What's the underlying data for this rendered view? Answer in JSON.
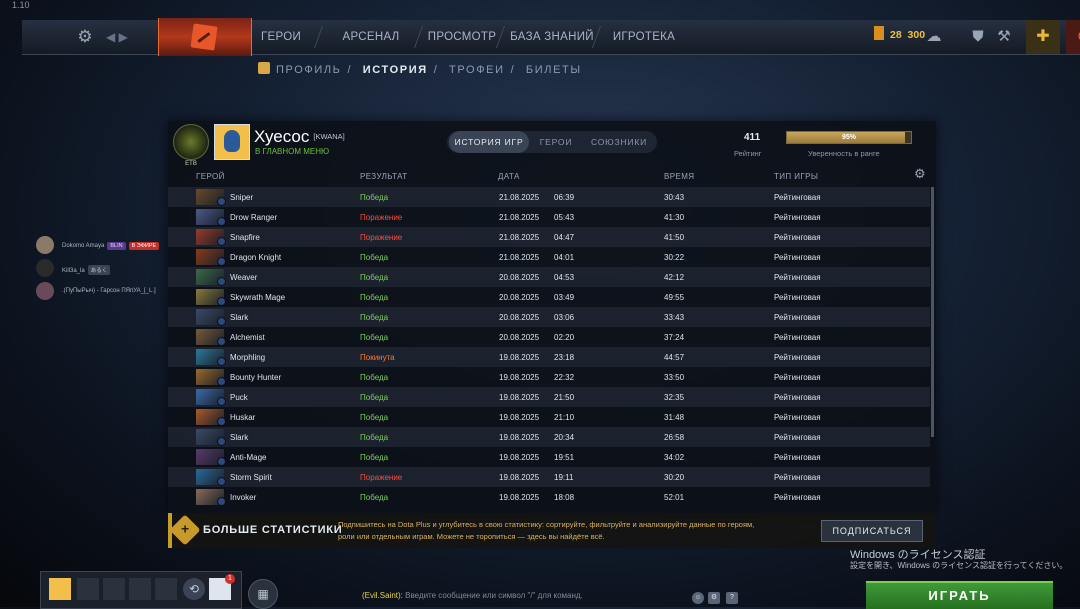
{
  "version": "1.10",
  "topnav": {
    "items": [
      "ГЕРОИ",
      "АРСЕНАЛ",
      "ПРОСМОТР",
      "БАЗА ЗНАНИЙ",
      "ИГРОТЕКА"
    ],
    "currency_a": "28",
    "currency_b": "300"
  },
  "subnav": {
    "items": [
      "ПРОФИЛЬ",
      "ИСТОРИЯ",
      "ТРОФЕИ",
      "БИЛЕТЫ"
    ],
    "active": "ИСТОРИЯ"
  },
  "profile": {
    "rank_label": "ETB",
    "name": "Хуесос",
    "tag": "[KWANA]",
    "status": "В ГЛАВНОМ МЕНЮ",
    "tabs": [
      "ИСТОРИЯ ИГР",
      "ГЕРОИ",
      "СОЮЗНИКИ"
    ],
    "rating": "411",
    "rating_label": "Рейтинг",
    "confidence_pct": 95,
    "confidence_text": "95%",
    "confidence_label": "Уверенность в ранге"
  },
  "table": {
    "headers": {
      "hero": "ГЕРОЙ",
      "result": "РЕЗУЛЬТАТ",
      "date": "ДАТА",
      "time": "ВРЕМЯ",
      "type": "ТИП ИГРЫ"
    },
    "rows": [
      {
        "hero": "Sniper",
        "result": "Победа",
        "rk": "win",
        "date": "21.08.2025",
        "clock": "06:39",
        "dur": "30:43",
        "type": "Рейтинговая",
        "c": "#6a4a2a"
      },
      {
        "hero": "Drow Ranger",
        "result": "Поражение",
        "rk": "loss",
        "date": "21.08.2025",
        "clock": "05:43",
        "dur": "41:30",
        "type": "Рейтинговая",
        "c": "#4a5a8a"
      },
      {
        "hero": "Snapfire",
        "result": "Поражение",
        "rk": "loss",
        "date": "21.08.2025",
        "clock": "04:47",
        "dur": "41:50",
        "type": "Рейтинговая",
        "c": "#9a3a2a"
      },
      {
        "hero": "Dragon Knight",
        "result": "Победа",
        "rk": "win",
        "date": "21.08.2025",
        "clock": "04:01",
        "dur": "30:22",
        "type": "Рейтинговая",
        "c": "#8a3a1a"
      },
      {
        "hero": "Weaver",
        "result": "Победа",
        "rk": "win",
        "date": "20.08.2025",
        "clock": "04:53",
        "dur": "42:12",
        "type": "Рейтинговая",
        "c": "#3a6a4a"
      },
      {
        "hero": "Skywrath Mage",
        "result": "Победа",
        "rk": "win",
        "date": "20.08.2025",
        "clock": "03:49",
        "dur": "49:55",
        "type": "Рейтинговая",
        "c": "#8a7a3a"
      },
      {
        "hero": "Slark",
        "result": "Победа",
        "rk": "win",
        "date": "20.08.2025",
        "clock": "03:06",
        "dur": "33:43",
        "type": "Рейтинговая",
        "c": "#3a4a6a"
      },
      {
        "hero": "Alchemist",
        "result": "Победа",
        "rk": "win",
        "date": "20.08.2025",
        "clock": "02:20",
        "dur": "37:24",
        "type": "Рейтинговая",
        "c": "#7a5a3a"
      },
      {
        "hero": "Morphling",
        "result": "Покинута",
        "rk": "left",
        "date": "19.08.2025",
        "clock": "23:18",
        "dur": "44:57",
        "type": "Рейтинговая",
        "c": "#2a7a9a"
      },
      {
        "hero": "Bounty Hunter",
        "result": "Победа",
        "rk": "win",
        "date": "19.08.2025",
        "clock": "22:32",
        "dur": "33:50",
        "type": "Рейтинговая",
        "c": "#9a6a2a"
      },
      {
        "hero": "Puck",
        "result": "Победа",
        "rk": "win",
        "date": "19.08.2025",
        "clock": "21:50",
        "dur": "32:35",
        "type": "Рейтинговая",
        "c": "#3a6aaa"
      },
      {
        "hero": "Huskar",
        "result": "Победа",
        "rk": "win",
        "date": "19.08.2025",
        "clock": "21:10",
        "dur": "31:48",
        "type": "Рейтинговая",
        "c": "#aa5a2a"
      },
      {
        "hero": "Slark",
        "result": "Победа",
        "rk": "win",
        "date": "19.08.2025",
        "clock": "20:34",
        "dur": "26:58",
        "type": "Рейтинговая",
        "c": "#3a4a6a"
      },
      {
        "hero": "Anti-Mage",
        "result": "Победа",
        "rk": "win",
        "date": "19.08.2025",
        "clock": "19:51",
        "dur": "34:02",
        "type": "Рейтинговая",
        "c": "#5a3a6a"
      },
      {
        "hero": "Storm Spirit",
        "result": "Поражение",
        "rk": "loss",
        "date": "19.08.2025",
        "clock": "19:11",
        "dur": "30:20",
        "type": "Рейтинговая",
        "c": "#2a6a9a"
      },
      {
        "hero": "Invoker",
        "result": "Победа",
        "rk": "win",
        "date": "19.08.2025",
        "clock": "18:08",
        "dur": "52:01",
        "type": "Рейтинговая",
        "c": "#8a6a5a"
      }
    ]
  },
  "plus": {
    "title": "БОЛЬШЕ СТАТИСТИКИ",
    "text": "Подпишитесь на Dota Plus и углубитесь в свою статистику: сортируйте, фильтруйте и анализируйте данные по героям, роли или отдельным играм. Можете не торопиться — здесь вы найдёте всё.",
    "button": "ПОДПИСАТЬСЯ"
  },
  "friends": [
    {
      "name": "Dokomo Amaya",
      "badge1": "BLIN",
      "badge2": "В ЭФИРЕ"
    },
    {
      "name": "Kill3a_la",
      "badge1": "あるく",
      "badge2": ""
    },
    {
      "name": ".(ПуПыРыч) - Гарсон ПЯпУА_[_L.]",
      "badge1": "",
      "badge2": ""
    }
  ],
  "windows": {
    "line1": "Windows のライセンス認証",
    "line2": "設定を開き、Windows のライセンス認証を行ってください。"
  },
  "chat": {
    "name": "(Evil.Saint):",
    "placeholder": "Введите сообщение или символ \"/\" для команд."
  },
  "party_notify": "1",
  "play": "ИГРАТЬ"
}
